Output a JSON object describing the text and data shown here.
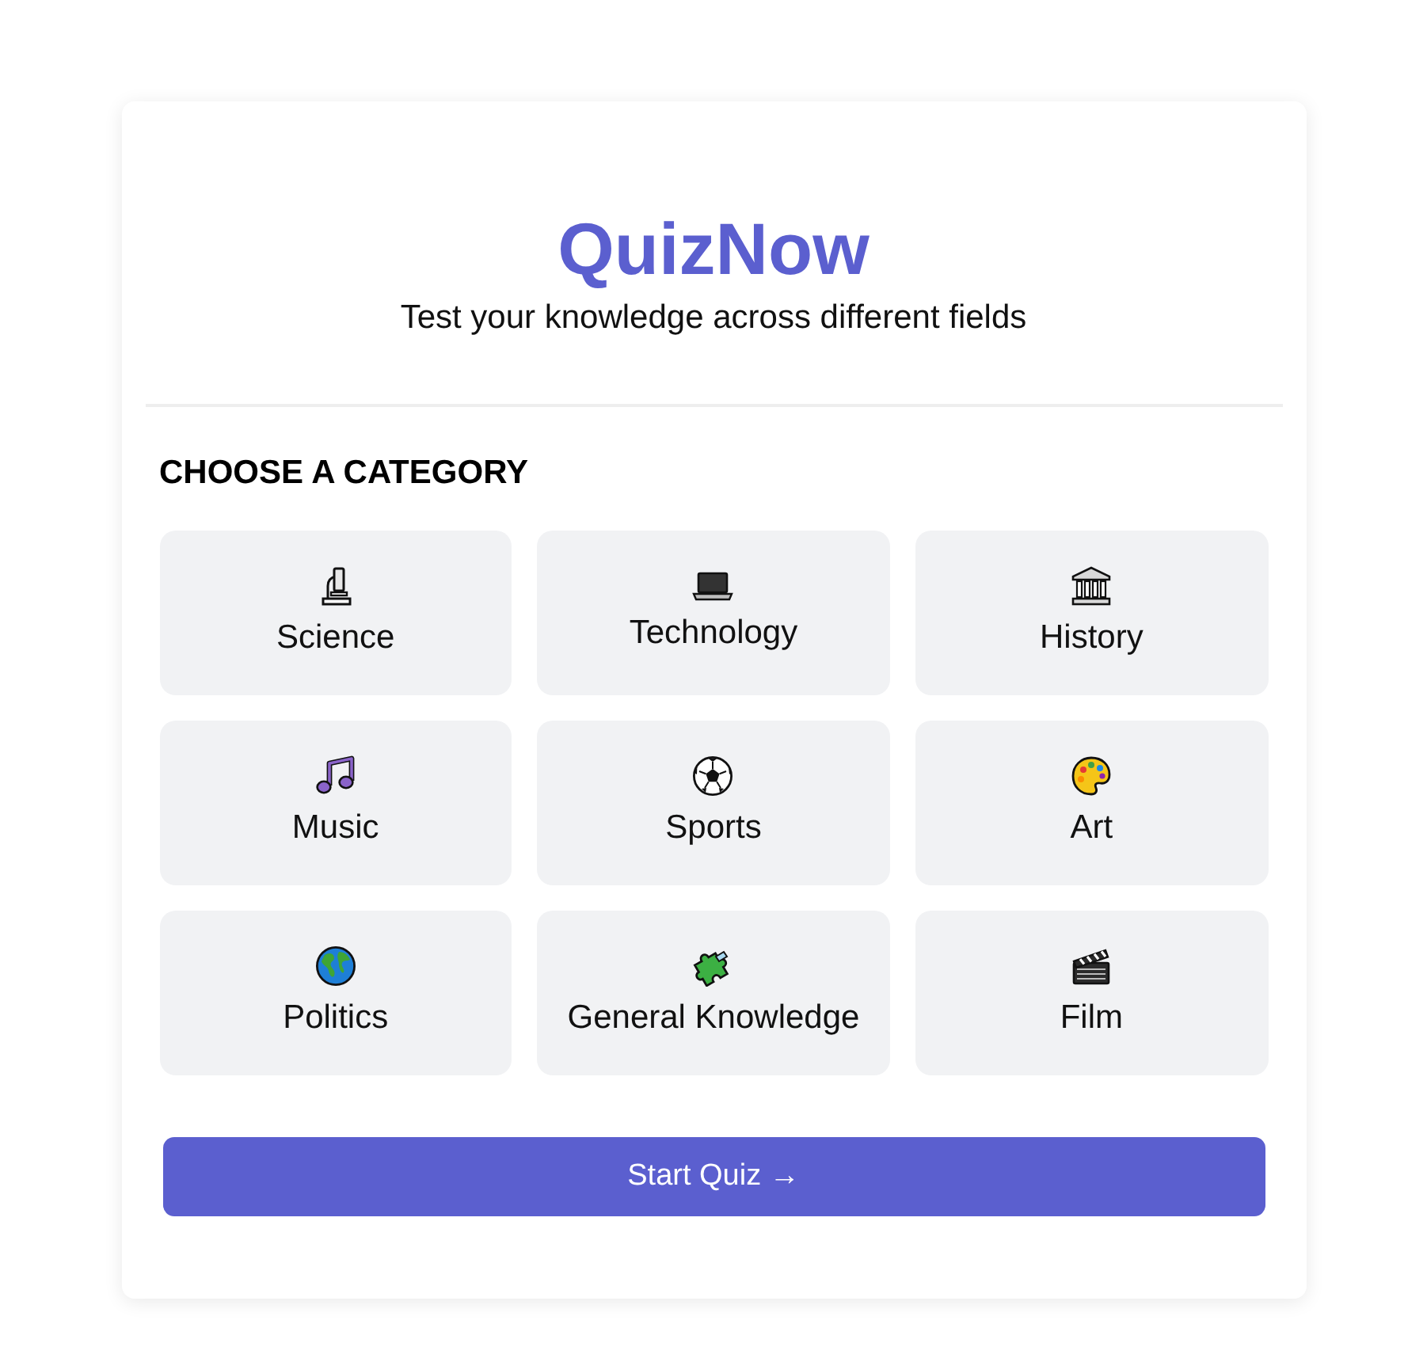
{
  "header": {
    "title": "QuizNow",
    "subtitle": "Test your knowledge across different fields"
  },
  "categories": {
    "heading": "CHOOSE A CATEGORY",
    "items": [
      {
        "label": "Science",
        "selected": false
      },
      {
        "label": "Technology",
        "selected": false
      },
      {
        "label": "History",
        "selected": false
      },
      {
        "label": "Music",
        "selected": false
      },
      {
        "label": "Sports",
        "selected": false
      },
      {
        "label": "Art",
        "selected": false
      },
      {
        "label": "Politics",
        "selected": false
      },
      {
        "label": "General Knowledge",
        "selected": false
      },
      {
        "label": "Film",
        "selected": false
      }
    ]
  },
  "start_button": {
    "label": "Start Quiz →"
  }
}
